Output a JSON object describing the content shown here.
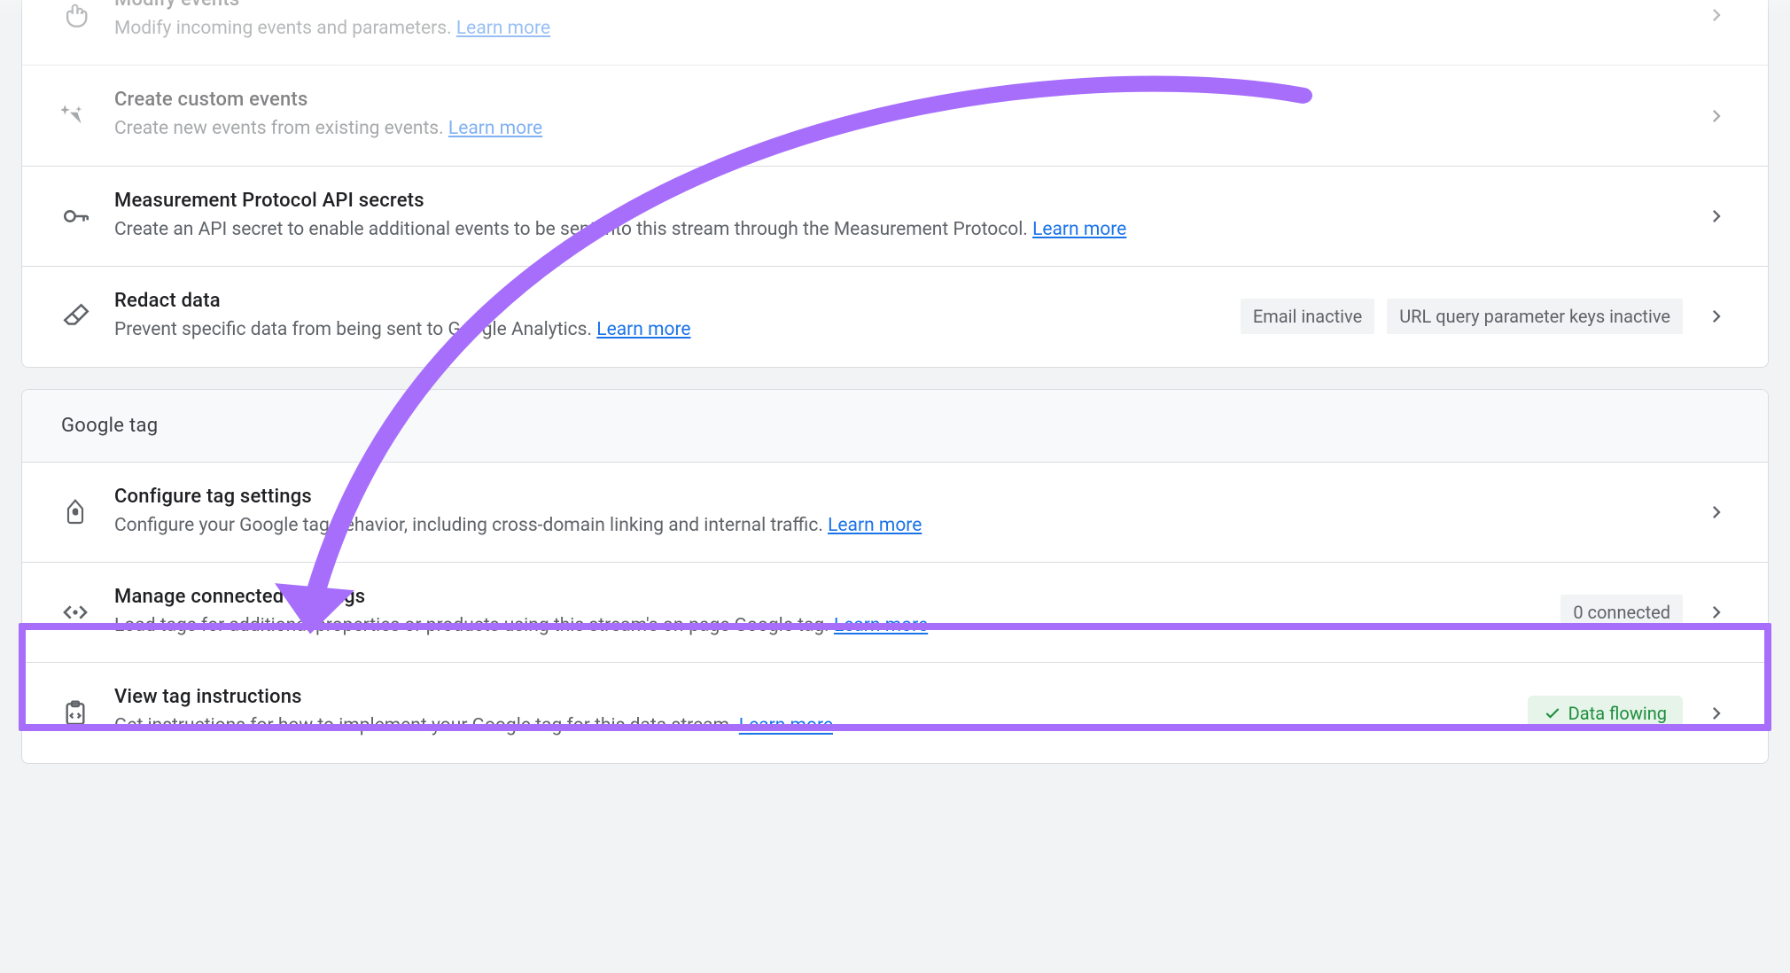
{
  "learn_more": "Learn more",
  "events_section": {
    "modify": {
      "title": "Modify events",
      "desc": "Modify incoming events and parameters."
    },
    "custom": {
      "title": "Create custom events",
      "desc": "Create new events from existing events."
    },
    "api_secrets": {
      "title": "Measurement Protocol API secrets",
      "desc": "Create an API secret to enable additional events to be sent into this stream through the Measurement Protocol."
    },
    "redact": {
      "title": "Redact data",
      "desc": "Prevent specific data from being sent to Google Analytics.",
      "tags": [
        "Email inactive",
        "URL query parameter keys inactive"
      ]
    }
  },
  "google_tag_section": {
    "header": "Google tag",
    "configure": {
      "title": "Configure tag settings",
      "desc": "Configure your Google tag behavior, including cross-domain linking and internal traffic."
    },
    "connected": {
      "title": "Manage connected site tags",
      "desc": "Load tags for additional properties or products using this stream's on-page Google tag.",
      "count": "0 connected"
    },
    "instructions": {
      "title": "View tag instructions",
      "desc": "Get instructions for how to implement your Google tag for this data stream.",
      "pill": "Data flowing"
    }
  }
}
